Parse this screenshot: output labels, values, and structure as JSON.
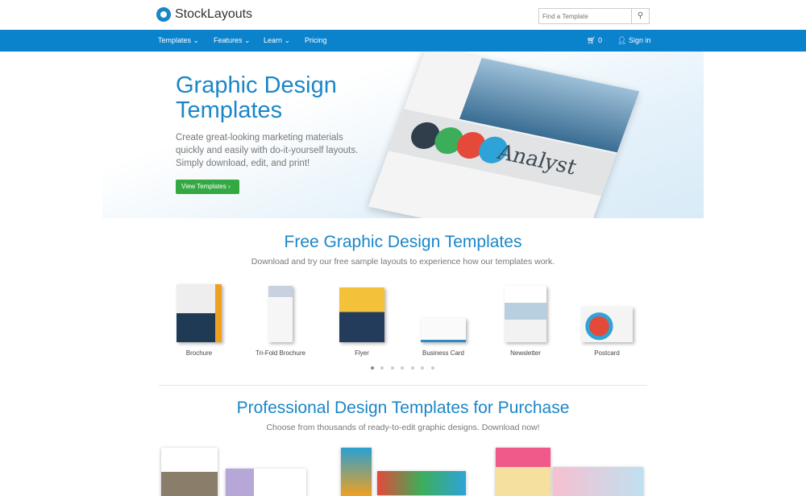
{
  "header": {
    "brand": "StockLayouts",
    "search_placeholder": "Find a Template"
  },
  "nav": {
    "items": [
      {
        "label": "Templates ⌄"
      },
      {
        "label": "Features ⌄"
      },
      {
        "label": "Learn ⌄"
      },
      {
        "label": "Pricing"
      }
    ],
    "cart_count": "0",
    "sign_in": "Sign in"
  },
  "hero": {
    "title_line1": "Graphic Design",
    "title_line2": "Templates",
    "desc_line1": "Create great-looking marketing materials",
    "desc_line2": "quickly and easily with do-it-yourself layouts.",
    "desc_line3": "Simply download, edit, and print!",
    "button": "View Templates  ›",
    "doc_headline": "Analyst"
  },
  "free": {
    "title": "Free Graphic Design Templates",
    "subtitle": "Download and try our free sample layouts to experience how our templates work.",
    "items": [
      {
        "label": "Brochure"
      },
      {
        "label": "Tri-Fold Brochure"
      },
      {
        "label": "Flyer"
      },
      {
        "label": "Business Card"
      },
      {
        "label": "Newsletter"
      },
      {
        "label": "Postcard"
      }
    ],
    "carousel_pages": 7,
    "carousel_active": 1
  },
  "purchase": {
    "title": "Professional Design Templates for Purchase",
    "subtitle": "Choose from thousands of ready-to-edit graphic designs. Download now!"
  },
  "colors": {
    "brand": "#1a86c8",
    "nav": "#0a82cc",
    "button": "#34a943"
  }
}
